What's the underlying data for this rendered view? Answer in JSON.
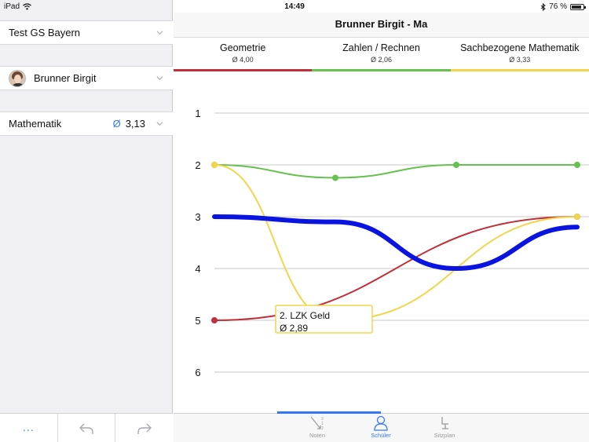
{
  "status_bar": {
    "device": "iPad",
    "time": "14:49",
    "battery": "76 %",
    "battery_level": 0.76
  },
  "sidebar": {
    "school": "Test GS Bayern",
    "student": "Brunner Birgit",
    "subject": "Mathematik",
    "subject_avg_symbol": "Ø",
    "subject_avg_value": "3,13",
    "toolbar": {
      "more_label": "..."
    }
  },
  "main": {
    "title": "Brunner Birgit - Ma",
    "subjects": [
      {
        "name": "Geometrie",
        "avg": "Ø 4,00",
        "color": "#c0303a"
      },
      {
        "name": "Zahlen / Rechnen",
        "avg": "Ø 2,06",
        "color": "#66c14f"
      },
      {
        "name": "Sachbezogene Mathematik",
        "avg": "Ø 3,33",
        "color": "#f2d54c"
      }
    ],
    "tooltip": {
      "title": "2. LZK Geld",
      "value": "Ø 2,89"
    },
    "tabs": [
      {
        "label": "Noten"
      },
      {
        "label": "Schüler"
      },
      {
        "label": "Sitzplan"
      }
    ]
  },
  "chart_data": {
    "type": "line",
    "x": [
      1,
      2,
      3,
      4
    ],
    "y_ticks": [
      "1",
      "2",
      "3",
      "4",
      "5",
      "6"
    ],
    "ylim": [
      1,
      6
    ],
    "y_inverted": true,
    "grid": true,
    "series": [
      {
        "name": "Geometrie",
        "color": "#c0303a",
        "values": [
          5,
          null,
          null,
          3
        ]
      },
      {
        "name": "Zahlen / Rechnen",
        "color": "#66c14f",
        "values": [
          2,
          2.25,
          2,
          2
        ]
      },
      {
        "name": "Sachbezogene Mathematik",
        "color": "#f2d54c",
        "values": [
          2,
          5,
          null,
          3
        ]
      },
      {
        "color": "#0a14e0",
        "values": [
          3,
          3.1,
          4,
          3.2
        ],
        "markers": false,
        "emphasis": true
      }
    ]
  }
}
